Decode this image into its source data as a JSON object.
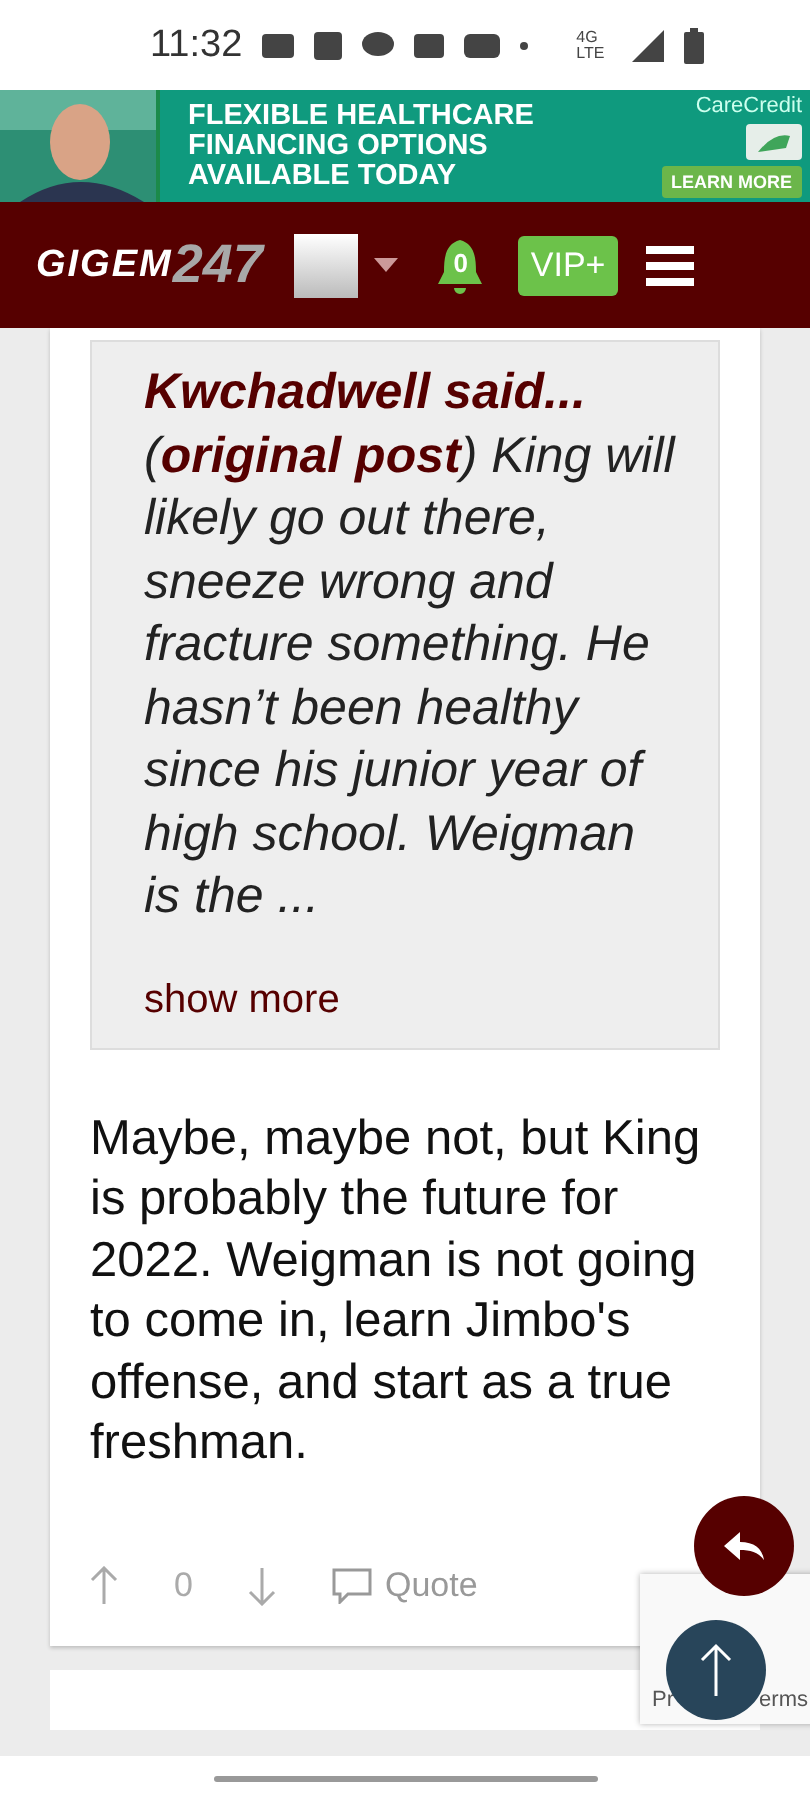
{
  "status_bar": {
    "time": "11:32",
    "network": "4G LTE"
  },
  "ad": {
    "headline": [
      "FLEXIBLE HEALTHCARE",
      "FINANCING OPTIONS",
      "AVAILABLE TODAY"
    ],
    "brand": "CareCredit",
    "cta": "LEARN MORE"
  },
  "header": {
    "logo_main": "GIGEM",
    "logo_num": "247",
    "notifications": "0",
    "vip": "VIP+"
  },
  "quote": {
    "author": "Kwchadwell said...",
    "text": "(**original post**) King will likely go out there, sneeze wrong and fracture something. He hasn’t been healthy since his junior year of high school. Weigman is the ...",
    "more": "show more"
  },
  "post": {
    "text": "Maybe, maybe not, but King is probably the future for 2022. Weigman is not going to come in, learn Jimbo's offense, and start as a true freshman.",
    "score": "0",
    "quote_label": "Quote"
  },
  "recaptcha": {
    "left": "Pr",
    "right": "erms"
  }
}
